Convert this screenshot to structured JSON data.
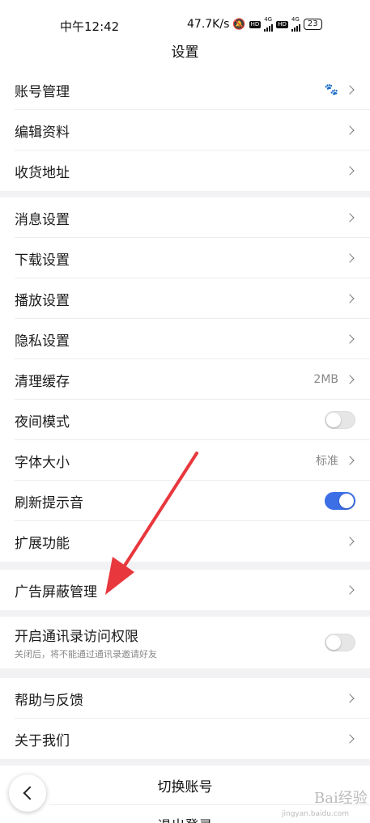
{
  "status_bar": {
    "time": "中午12:42",
    "network_speed": "47.7K/s",
    "hd1": "HD",
    "net1": "4G",
    "hd2": "HD",
    "net2": "4G",
    "battery": "23"
  },
  "header": {
    "title": "设置"
  },
  "groups": {
    "account": {
      "items": [
        {
          "label": "账号管理",
          "value": ""
        },
        {
          "label": "编辑资料",
          "value": ""
        },
        {
          "label": "收货地址",
          "value": ""
        }
      ]
    },
    "general": {
      "items": [
        {
          "label": "消息设置",
          "value": ""
        },
        {
          "label": "下载设置",
          "value": ""
        },
        {
          "label": "播放设置",
          "value": ""
        },
        {
          "label": "隐私设置",
          "value": ""
        },
        {
          "label": "清理缓存",
          "value": "2MB"
        },
        {
          "label": "夜间模式",
          "value": "",
          "toggle": false
        },
        {
          "label": "字体大小",
          "value": "标准"
        },
        {
          "label": "刷新提示音",
          "value": "",
          "toggle": true
        },
        {
          "label": "扩展功能",
          "value": ""
        }
      ]
    },
    "ads": {
      "items": [
        {
          "label": "广告屏蔽管理",
          "value": ""
        }
      ]
    },
    "contacts": {
      "items": [
        {
          "label": "开启通讯录访问权限",
          "sub": "关闭后，将不能通过通讯录邀请好友",
          "toggle": false
        }
      ]
    },
    "about": {
      "items": [
        {
          "label": "帮助与反馈",
          "value": ""
        },
        {
          "label": "关于我们",
          "value": ""
        }
      ]
    }
  },
  "bottom": {
    "switch_account": "切换账号",
    "logout": "退出登录"
  },
  "watermark": {
    "brand": "Bai经验",
    "domain": "jingyan.baidu.com"
  },
  "colors": {
    "accent": "#3c6fe6",
    "annotation": "#e8383d"
  }
}
